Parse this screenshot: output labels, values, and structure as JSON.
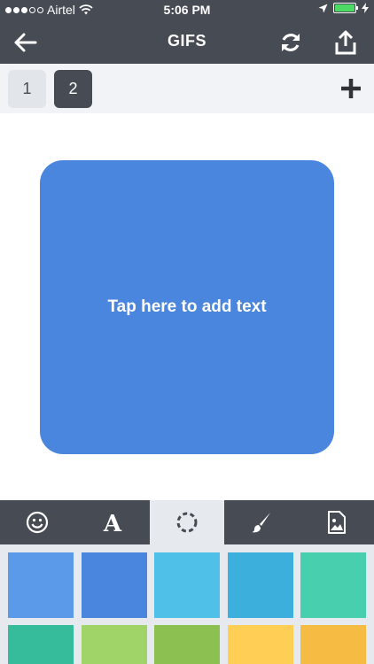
{
  "status": {
    "carrier": "Airtel",
    "time": "5:06 PM",
    "battery_level": 1.0
  },
  "navbar": {
    "title": "GIFS",
    "icons": [
      "back-arrow-icon",
      "refresh-icon",
      "share-icon"
    ]
  },
  "pages": {
    "tabs": [
      {
        "label": "1",
        "selected": false
      },
      {
        "label": "2",
        "selected": true
      }
    ],
    "add_icon": "plus-icon"
  },
  "canvas": {
    "placeholder": "Tap here to add text",
    "background_color": "#4a86dd"
  },
  "toolbar": {
    "tools": [
      {
        "name": "emoji-icon",
        "selected": false
      },
      {
        "name": "font-icon",
        "selected": false
      },
      {
        "name": "border-icon",
        "selected": true
      },
      {
        "name": "brush-icon",
        "selected": false
      },
      {
        "name": "image-icon",
        "selected": false
      }
    ]
  },
  "swatches": {
    "colors": [
      "#5b9ae8",
      "#4a86dd",
      "#4fc1e8",
      "#3cafdd",
      "#48cfad",
      "#37bc9b",
      "#a0d468",
      "#8cc152",
      "#ffce54",
      "#f6bb42"
    ]
  }
}
